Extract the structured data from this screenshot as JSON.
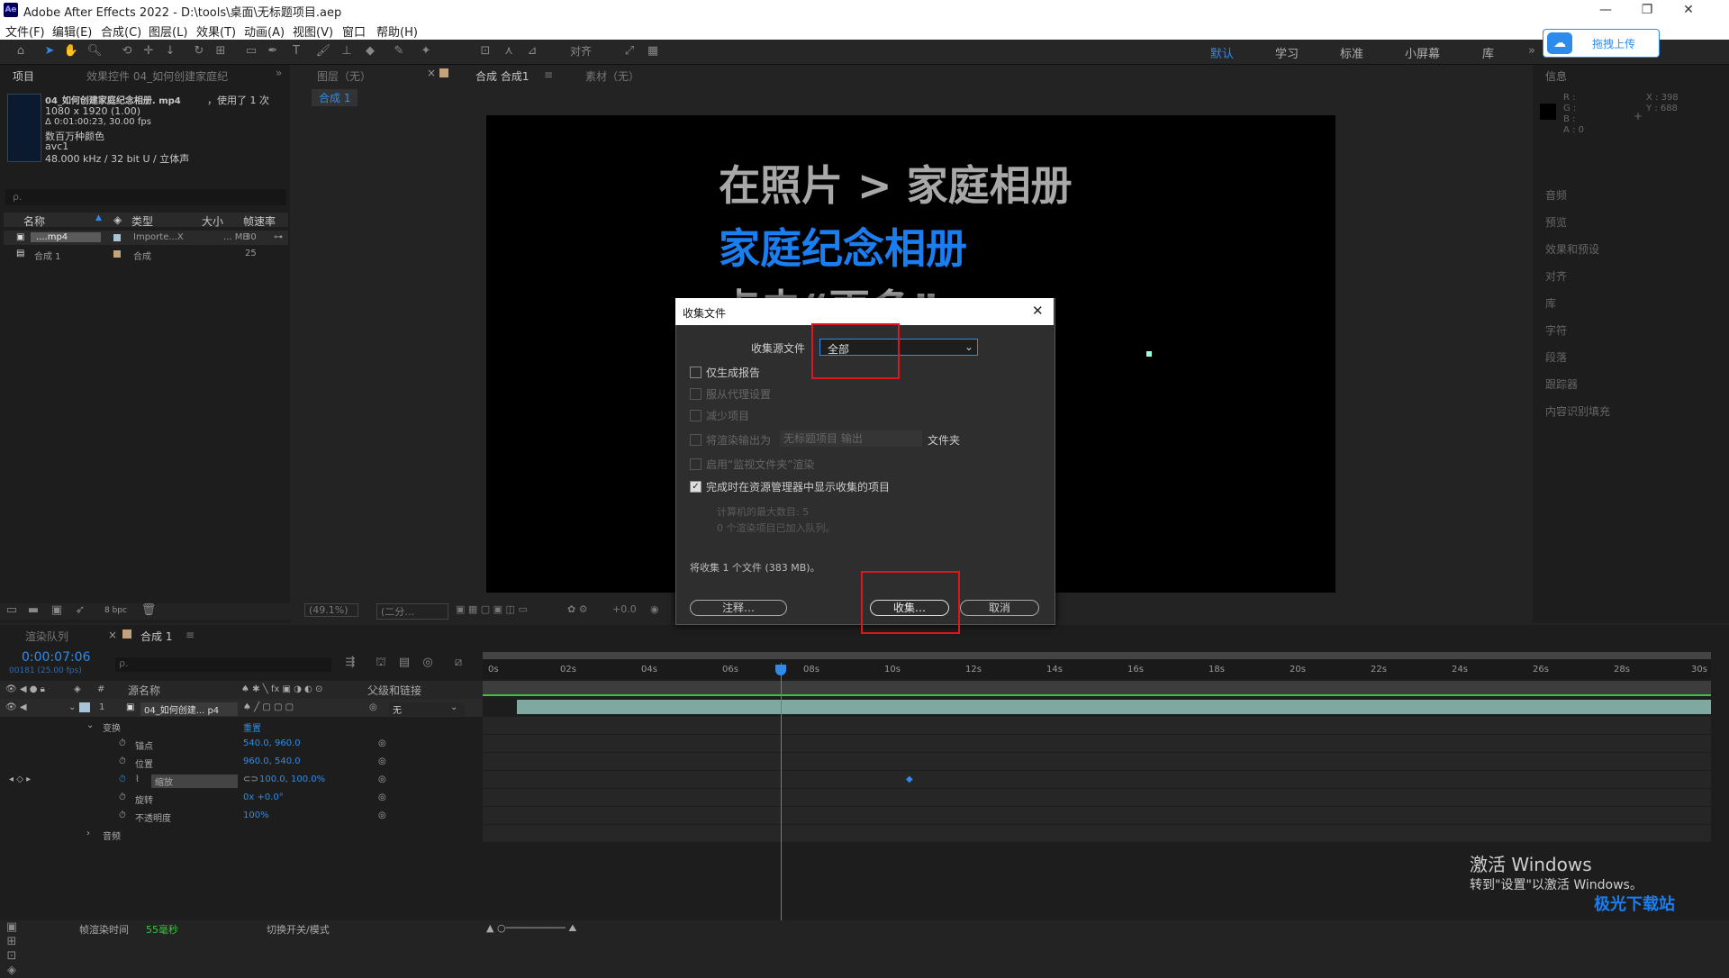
{
  "window": {
    "title": "Adobe After Effects 2022 - D:\\tools\\桌面\\无标题项目.aep",
    "logo": "Ae"
  },
  "menu": [
    "文件(F)",
    "编辑(E)",
    "合成(C)",
    "图层(L)",
    "效果(T)",
    "动画(A)",
    "视图(V)",
    "窗口",
    "帮助(H)"
  ],
  "toolbar": {
    "align_label": "对齐",
    "workspaces": [
      "默认",
      "学习",
      "标准",
      "小屏幕",
      "库"
    ]
  },
  "cloud_upload": {
    "label": "拖拽上传"
  },
  "project_panel": {
    "tab_project": "项目",
    "tab_effects": "效果控件 04_如何创建家庭纪",
    "file_name": "04_如何创建家庭纪念相册. mp4",
    "used_count": "，使用了 1 次",
    "resolution": "1080 x 1920 (1.00)",
    "duration": "Δ 0:01:00:23, 30.00 fps",
    "colors": "数百万种颜色",
    "codec": "avc1",
    "audio": "48.000 kHz / 32 bit U / 立体声",
    "search_placeholder": "ρ.",
    "columns": [
      "名称",
      "类型",
      "大小",
      "帧速率"
    ],
    "items": [
      {
        "name": "....mp4",
        "type": "Importe...X",
        "size": "... MB",
        "fps": "30"
      },
      {
        "name": "合成 1",
        "type": "合成",
        "size": "",
        "fps": "25"
      }
    ],
    "bpc": "8 bpc"
  },
  "comp_panel": {
    "tab_layer": "图层（无）",
    "tab_comp": "合成 合成1",
    "tab_footage": "素材（无）",
    "comp_chip": "合成 1",
    "zoom": "(49.1%)",
    "quality": "(二分…",
    "offset": "+0.0",
    "viewer_lines": [
      {
        "text": "在照片 > 家庭相册",
        "color": "#ffffff"
      },
      {
        "text": "家庭纪念相册",
        "color": "#1a7ef0"
      },
      {
        "text": "点击“更多”",
        "color": "#ffffff"
      }
    ]
  },
  "info_panel": {
    "title": "信息",
    "channels": [
      "R :",
      "G :",
      "B :",
      "A : 0"
    ],
    "coords": [
      "X : 398",
      "Y : 688"
    ],
    "panels": [
      "音频",
      "预览",
      "效果和预设",
      "对齐",
      "库",
      "字符",
      "段落",
      "跟踪器",
      "内容识别填充"
    ]
  },
  "dialog": {
    "title": "收集文件",
    "source_label": "收集源文件",
    "source_value": "全部",
    "options": [
      {
        "label": "仅生成报告",
        "checked": false,
        "disabled": false
      },
      {
        "label": "服从代理设置",
        "checked": false,
        "disabled": true
      },
      {
        "label": "减少项目",
        "checked": false,
        "disabled": true
      },
      {
        "label": "将渲染输出为",
        "checked": false,
        "disabled": true
      },
      {
        "label": "启用“监视文件夹”渲染",
        "checked": false,
        "disabled": true
      },
      {
        "label": "完成时在资源管理器中显示收集的项目",
        "checked": true,
        "disabled": false
      }
    ],
    "render_field": "无标题项目 输出",
    "folder_suffix": "文件夹",
    "max_machines": "计算机的最大数目: 5",
    "queued": "0 个渲染项目已加入队列。",
    "summary": "将收集 1 个文件 (383 MB)。",
    "btn_comment": "注释…",
    "btn_collect": "收集…",
    "btn_cancel": "取消"
  },
  "timeline": {
    "tab_render": "渲染队列",
    "tab_comp": "合成 1",
    "timecode": "0:00:07:06",
    "frame": "00181 (25.00 fps)",
    "search_placeholder": "ρ.",
    "col_source": "源名称",
    "col_parent": "父级和链接",
    "layer": {
      "num": "1",
      "name": "04_如何创建... p4",
      "parent": "无"
    },
    "transform_label": "变换",
    "reset": "重置",
    "props": [
      {
        "name": "锚点",
        "value": "540.0, 960.0"
      },
      {
        "name": "位置",
        "value": "960.0, 540.0"
      },
      {
        "name": "缩放",
        "value": "100.0, 100.0%"
      },
      {
        "name": "旋转",
        "value": "0x +0.0°"
      },
      {
        "name": "不透明度",
        "value": "100%"
      }
    ],
    "audio_label": "音频",
    "ticks": [
      "0s",
      "02s",
      "04s",
      "06s",
      "08s",
      "10s",
      "12s",
      "14s",
      "16s",
      "18s",
      "20s",
      "22s",
      "24s",
      "26s",
      "28s",
      "30s"
    ]
  },
  "statusbar": {
    "render_time_label": "帧渲染时间",
    "render_time": "55毫秒",
    "toggle": "切换开关/模式"
  },
  "activation": {
    "line1": "激活 Windows",
    "line2": "转到\"设置\"以激活 Windows。"
  },
  "site_watermark": "极光下载站"
}
